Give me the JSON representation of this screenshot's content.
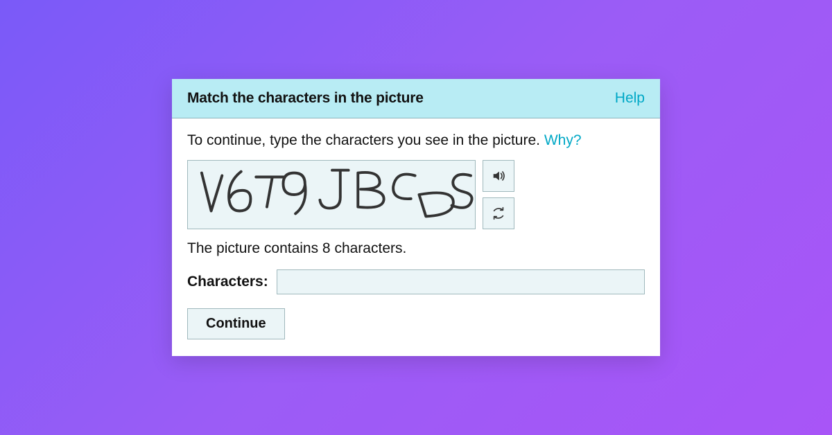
{
  "header": {
    "title": "Match the characters in the picture",
    "help_label": "Help"
  },
  "body": {
    "prompt_text": "To continue, type the characters you see in the picture. ",
    "why_label": "Why?",
    "captcha_text": "V6T9JBCDS",
    "hint_text": "The picture contains 8 characters.",
    "input_label": "Characters:",
    "input_value": "",
    "continue_label": "Continue"
  },
  "icons": {
    "audio": "audio-icon",
    "refresh": "refresh-icon"
  }
}
